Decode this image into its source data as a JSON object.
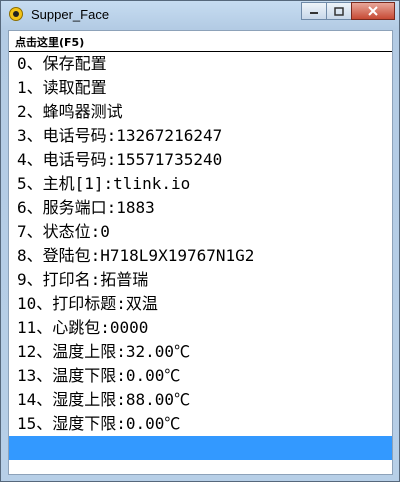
{
  "window": {
    "title": "Supper_Face"
  },
  "menu": {
    "label": "点击这里(F5)"
  },
  "items": [
    "0、保存配置",
    "1、读取配置",
    "2、蜂鸣器测试",
    "3、电话号码:13267216247",
    "4、电话号码:15571735240",
    "5、主机[1]:tlink.io",
    "6、服务端口:1883",
    "7、状态位:0",
    "8、登陆包:H718L9X19767N1G2",
    "9、打印名:拓普瑞",
    "10、打印标题:双温",
    "11、心跳包:0000",
    "12、温度上限:32.00℃",
    "13、温度下限:0.00℃",
    "14、湿度上限:88.00℃",
    "15、湿度下限:0.00℃",
    ""
  ],
  "selected_index": 16,
  "icons": {
    "app": "app-icon",
    "minimize": "minimize-icon",
    "maximize": "maximize-icon",
    "close": "close-icon"
  }
}
